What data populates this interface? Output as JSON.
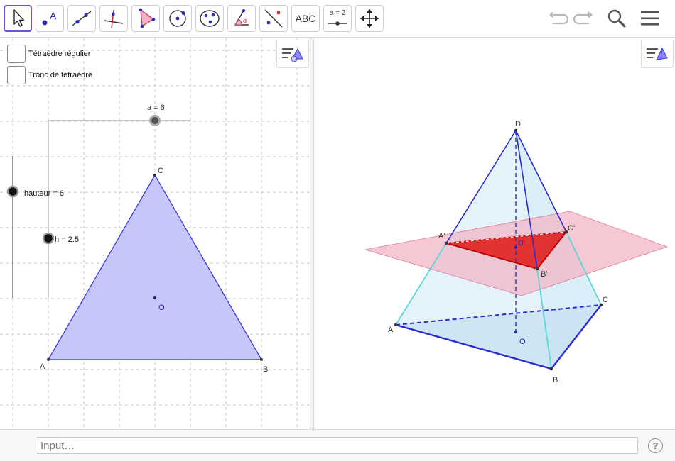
{
  "toolbar": {
    "tools": [
      {
        "id": "move",
        "icon": "cursor-arrow-icon",
        "active": true
      },
      {
        "id": "point",
        "icon": "point-icon",
        "label": "A"
      },
      {
        "id": "line",
        "icon": "line-through-points-icon"
      },
      {
        "id": "perpendicular",
        "icon": "perpendicular-line-icon"
      },
      {
        "id": "polygon",
        "icon": "polygon-icon"
      },
      {
        "id": "circle",
        "icon": "circle-center-point-icon"
      },
      {
        "id": "conic",
        "icon": "circle-three-points-icon"
      },
      {
        "id": "angle",
        "icon": "angle-icon",
        "label": "α"
      },
      {
        "id": "reflect",
        "icon": "reflect-line-icon"
      },
      {
        "id": "text",
        "icon": "text-icon",
        "label": "ABC"
      },
      {
        "id": "slider",
        "icon": "slider-icon",
        "label": "a = 2"
      },
      {
        "id": "move-view",
        "icon": "move-graphics-view-icon"
      }
    ],
    "right": [
      {
        "id": "undo",
        "icon": "undo-icon"
      },
      {
        "id": "redo",
        "icon": "redo-icon"
      },
      {
        "id": "search",
        "icon": "search-icon"
      },
      {
        "id": "menu",
        "icon": "hamburger-menu-icon"
      }
    ]
  },
  "view2d": {
    "checkboxes": [
      {
        "label": "Tétraèdre régulier",
        "checked": false
      },
      {
        "label": "Tronc de tétraèdre",
        "checked": false
      }
    ],
    "sliders": {
      "a": "a = 6",
      "hauteur": "hauteur = 6",
      "h": "h = 2.5"
    },
    "points": {
      "A": "A",
      "B": "B",
      "C": "C",
      "O": "O"
    },
    "colors": {
      "triangle_fill": "#c3c3f8",
      "triangle_stroke": "#3a3ae0",
      "grid": "#c8c8c8"
    }
  },
  "view3d": {
    "points": {
      "A": "A",
      "B": "B",
      "C": "C",
      "D": "D",
      "O": "O",
      "A1": "A'",
      "B1": "B'",
      "C1": "C'",
      "O1": "O'"
    },
    "colors": {
      "plane": "#f2b6c6",
      "section": "#e01818",
      "edges": "#2b2bd6",
      "faces": "#cfe8f5"
    }
  },
  "inputbar": {
    "placeholder": "Input…",
    "help": "?"
  }
}
